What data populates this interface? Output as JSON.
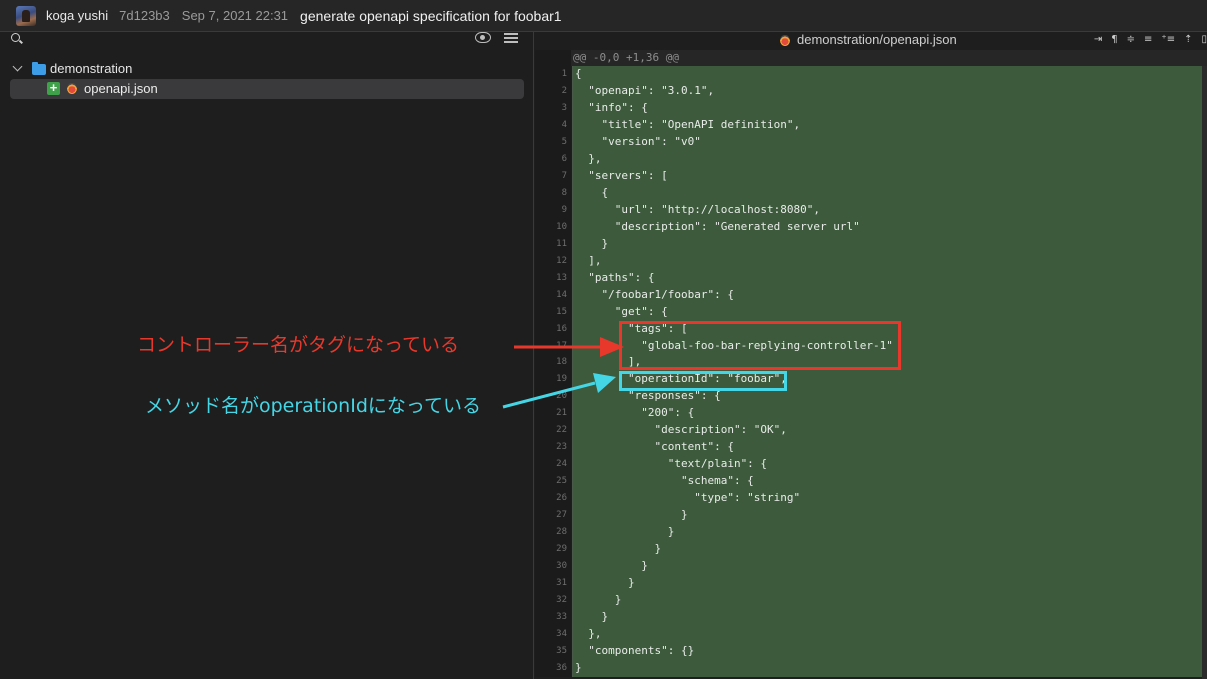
{
  "titlebar": {
    "author": "koga yushi",
    "hash": "7d123b3",
    "date": "Sep 7, 2021 22:31",
    "message": "generate openapi specification for foobar1"
  },
  "sidebar": {
    "folder": "demonstration",
    "file": "openapi.json"
  },
  "diff": {
    "file_path": "demonstration/openapi.json",
    "toolbar_icons": [
      "text-wrap-icon",
      "pilcrow-icon",
      "filter-icon",
      "align-icon",
      "add-lines-icon",
      "collapse-icon",
      "split-view-icon"
    ],
    "hunk_header": "@@ -0,0 +1,36 @@",
    "lines": [
      {
        "n": "1",
        "t": "{"
      },
      {
        "n": "2",
        "t": "  \"openapi\": \"3.0.1\","
      },
      {
        "n": "3",
        "t": "  \"info\": {"
      },
      {
        "n": "4",
        "t": "    \"title\": \"OpenAPI definition\","
      },
      {
        "n": "5",
        "t": "    \"version\": \"v0\""
      },
      {
        "n": "6",
        "t": "  },"
      },
      {
        "n": "7",
        "t": "  \"servers\": ["
      },
      {
        "n": "8",
        "t": "    {"
      },
      {
        "n": "9",
        "t": "      \"url\": \"http://localhost:8080\","
      },
      {
        "n": "10",
        "t": "      \"description\": \"Generated server url\""
      },
      {
        "n": "11",
        "t": "    }"
      },
      {
        "n": "12",
        "t": "  ],"
      },
      {
        "n": "13",
        "t": "  \"paths\": {"
      },
      {
        "n": "14",
        "t": "    \"/foobar1/foobar\": {"
      },
      {
        "n": "15",
        "t": "      \"get\": {"
      },
      {
        "n": "16",
        "t": "        \"tags\": ["
      },
      {
        "n": "17",
        "t": "          \"global-foo-bar-replying-controller-1\""
      },
      {
        "n": "18",
        "t": "        ],"
      },
      {
        "n": "19",
        "t": "        \"operationId\": \"foobar\","
      },
      {
        "n": "20",
        "t": "        \"responses\": {"
      },
      {
        "n": "21",
        "t": "          \"200\": {"
      },
      {
        "n": "22",
        "t": "            \"description\": \"OK\","
      },
      {
        "n": "23",
        "t": "            \"content\": {"
      },
      {
        "n": "24",
        "t": "              \"text/plain\": {"
      },
      {
        "n": "25",
        "t": "                \"schema\": {"
      },
      {
        "n": "26",
        "t": "                  \"type\": \"string\""
      },
      {
        "n": "27",
        "t": "                }"
      },
      {
        "n": "28",
        "t": "              }"
      },
      {
        "n": "29",
        "t": "            }"
      },
      {
        "n": "30",
        "t": "          }"
      },
      {
        "n": "31",
        "t": "        }"
      },
      {
        "n": "32",
        "t": "      }"
      },
      {
        "n": "33",
        "t": "    }"
      },
      {
        "n": "34",
        "t": "  },"
      },
      {
        "n": "35",
        "t": "  \"components\": {}"
      },
      {
        "n": "36",
        "t": "}"
      }
    ]
  },
  "annotations": {
    "tags_note": "コントローラー名がタグになっている",
    "operation_note": "メソッド名がoperationIdになっている",
    "tags_color": "#e8382b",
    "operation_color": "#45d6e6"
  },
  "colors": {
    "added_line_bg": "#3d5a3d",
    "added_badge": "#3fa14a",
    "folder": "#3d9de6"
  }
}
